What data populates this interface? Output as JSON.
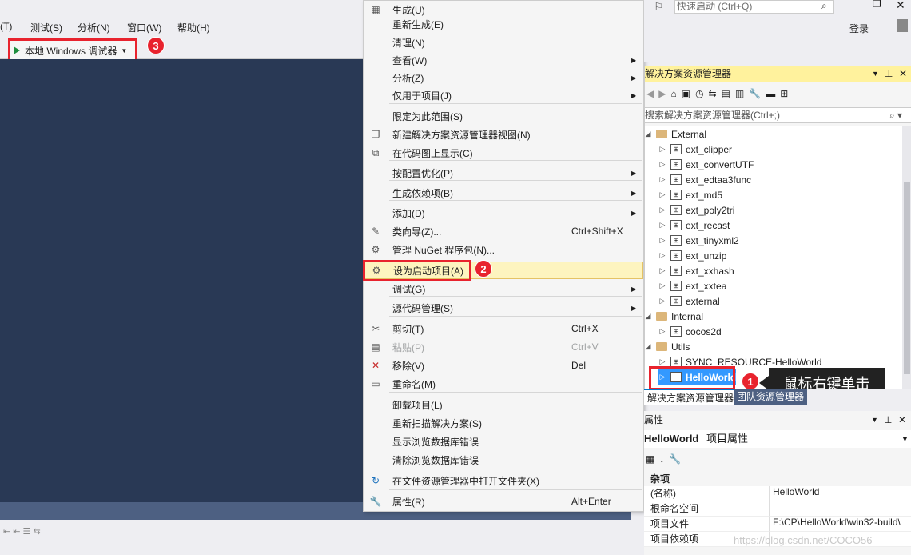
{
  "menubar": {
    "items": [
      "(T)",
      "测试(S)",
      "分析(N)",
      "窗口(W)",
      "帮助(H)"
    ]
  },
  "toolbar": {
    "debug_label": "本地 Windows 调试器",
    "badge3": "3"
  },
  "context_menu": {
    "items": [
      {
        "label": "生成(U)",
        "shortcut": "",
        "submenu": false,
        "icon": "build-icon",
        "disabled": false
      },
      {
        "label": "重新生成(E)",
        "shortcut": "",
        "submenu": false,
        "icon": "",
        "disabled": false
      },
      {
        "label": "清理(N)",
        "shortcut": "",
        "submenu": false,
        "icon": "",
        "disabled": false
      },
      {
        "label": "查看(W)",
        "shortcut": "",
        "submenu": true,
        "icon": "",
        "disabled": false
      },
      {
        "label": "分析(Z)",
        "shortcut": "",
        "submenu": true,
        "icon": "",
        "disabled": false
      },
      {
        "label": "仅用于项目(J)",
        "shortcut": "",
        "submenu": true,
        "icon": "",
        "disabled": false
      },
      {
        "label": "限定为此范围(S)",
        "shortcut": "",
        "submenu": false,
        "icon": "",
        "disabled": false
      },
      {
        "label": "新建解决方案资源管理器视图(N)",
        "shortcut": "",
        "submenu": false,
        "icon": "new-view-icon",
        "disabled": false
      },
      {
        "label": "在代码图上显示(C)",
        "shortcut": "",
        "submenu": false,
        "icon": "code-map-icon",
        "disabled": false
      },
      {
        "label": "按配置优化(P)",
        "shortcut": "",
        "submenu": true,
        "icon": "",
        "disabled": false
      },
      {
        "label": "生成依赖项(B)",
        "shortcut": "",
        "submenu": true,
        "icon": "",
        "disabled": false
      },
      {
        "label": "添加(D)",
        "shortcut": "",
        "submenu": true,
        "icon": "",
        "disabled": false
      },
      {
        "label": "类向导(Z)...",
        "shortcut": "Ctrl+Shift+X",
        "submenu": false,
        "icon": "class-wizard-icon",
        "disabled": false
      },
      {
        "label": "管理 NuGet 程序包(N)...",
        "shortcut": "",
        "submenu": false,
        "icon": "nuget-icon",
        "disabled": false
      },
      {
        "label": "设为启动项目(A)",
        "shortcut": "",
        "submenu": false,
        "icon": "gear-icon",
        "disabled": false,
        "highlight": true
      },
      {
        "label": "调试(G)",
        "shortcut": "",
        "submenu": true,
        "icon": "",
        "disabled": false
      },
      {
        "label": "源代码管理(S)",
        "shortcut": "",
        "submenu": true,
        "icon": "",
        "disabled": false
      },
      {
        "label": "剪切(T)",
        "shortcut": "Ctrl+X",
        "submenu": false,
        "icon": "scissors-icon",
        "disabled": false
      },
      {
        "label": "粘贴(P)",
        "shortcut": "Ctrl+V",
        "submenu": false,
        "icon": "paste-icon",
        "disabled": true
      },
      {
        "label": "移除(V)",
        "shortcut": "Del",
        "submenu": false,
        "icon": "remove-x-icon",
        "disabled": false
      },
      {
        "label": "重命名(M)",
        "shortcut": "",
        "submenu": false,
        "icon": "rename-icon",
        "disabled": false
      },
      {
        "label": "卸载项目(L)",
        "shortcut": "",
        "submenu": false,
        "icon": "",
        "disabled": false
      },
      {
        "label": "重新扫描解决方案(S)",
        "shortcut": "",
        "submenu": false,
        "icon": "",
        "disabled": false
      },
      {
        "label": "显示浏览数据库错误",
        "shortcut": "",
        "submenu": false,
        "icon": "",
        "disabled": false
      },
      {
        "label": "清除浏览数据库错误",
        "shortcut": "",
        "submenu": false,
        "icon": "",
        "disabled": false
      },
      {
        "label": "在文件资源管理器中打开文件夹(X)",
        "shortcut": "",
        "submenu": false,
        "icon": "refresh-arrow-icon",
        "disabled": false
      },
      {
        "label": "属性(R)",
        "shortcut": "Alt+Enter",
        "submenu": false,
        "icon": "wrench-icon",
        "disabled": false
      }
    ],
    "badge2": "2"
  },
  "topright": {
    "quicklaunch_placeholder": "快速启动 (Ctrl+Q)",
    "login": "登录"
  },
  "solution_explorer": {
    "title": "解决方案资源管理器",
    "search_placeholder": "搜索解决方案资源管理器(Ctrl+;)",
    "tree": [
      {
        "label": "External",
        "type": "folder",
        "expanded": true
      },
      {
        "label": "ext_clipper",
        "type": "project"
      },
      {
        "label": "ext_convertUTF",
        "type": "project"
      },
      {
        "label": "ext_edtaa3func",
        "type": "project"
      },
      {
        "label": "ext_md5",
        "type": "project"
      },
      {
        "label": "ext_poly2tri",
        "type": "project"
      },
      {
        "label": "ext_recast",
        "type": "project"
      },
      {
        "label": "ext_tinyxml2",
        "type": "project"
      },
      {
        "label": "ext_unzip",
        "type": "project"
      },
      {
        "label": "ext_xxhash",
        "type": "project"
      },
      {
        "label": "ext_xxtea",
        "type": "project"
      },
      {
        "label": "external",
        "type": "project"
      },
      {
        "label": "Internal",
        "type": "folder",
        "expanded": true
      },
      {
        "label": "cocos2d",
        "type": "project"
      },
      {
        "label": "Utils",
        "type": "folder",
        "expanded": true
      },
      {
        "label": "SYNC_RESOURCE-HelloWorld",
        "type": "project"
      },
      {
        "label": "HelloWorld",
        "type": "project",
        "selected": true
      }
    ],
    "badge1": "1",
    "tooltip": "鼠标右键单击",
    "tabs": [
      "解决方案资源管理器",
      "团队资源管理器"
    ]
  },
  "properties": {
    "title": "属性",
    "object_name": "HelloWorld",
    "object_type": "项目属性",
    "category": "杂项",
    "rows": [
      {
        "key": "(名称)",
        "value": "HelloWorld"
      },
      {
        "key": "根命名空间",
        "value": ""
      },
      {
        "key": "项目文件",
        "value": "F:\\CP\\HelloWorld\\win32-build\\"
      },
      {
        "key": "项目依赖项",
        "value": ""
      }
    ]
  },
  "watermark": "https://blog.csdn.net/COCO56"
}
